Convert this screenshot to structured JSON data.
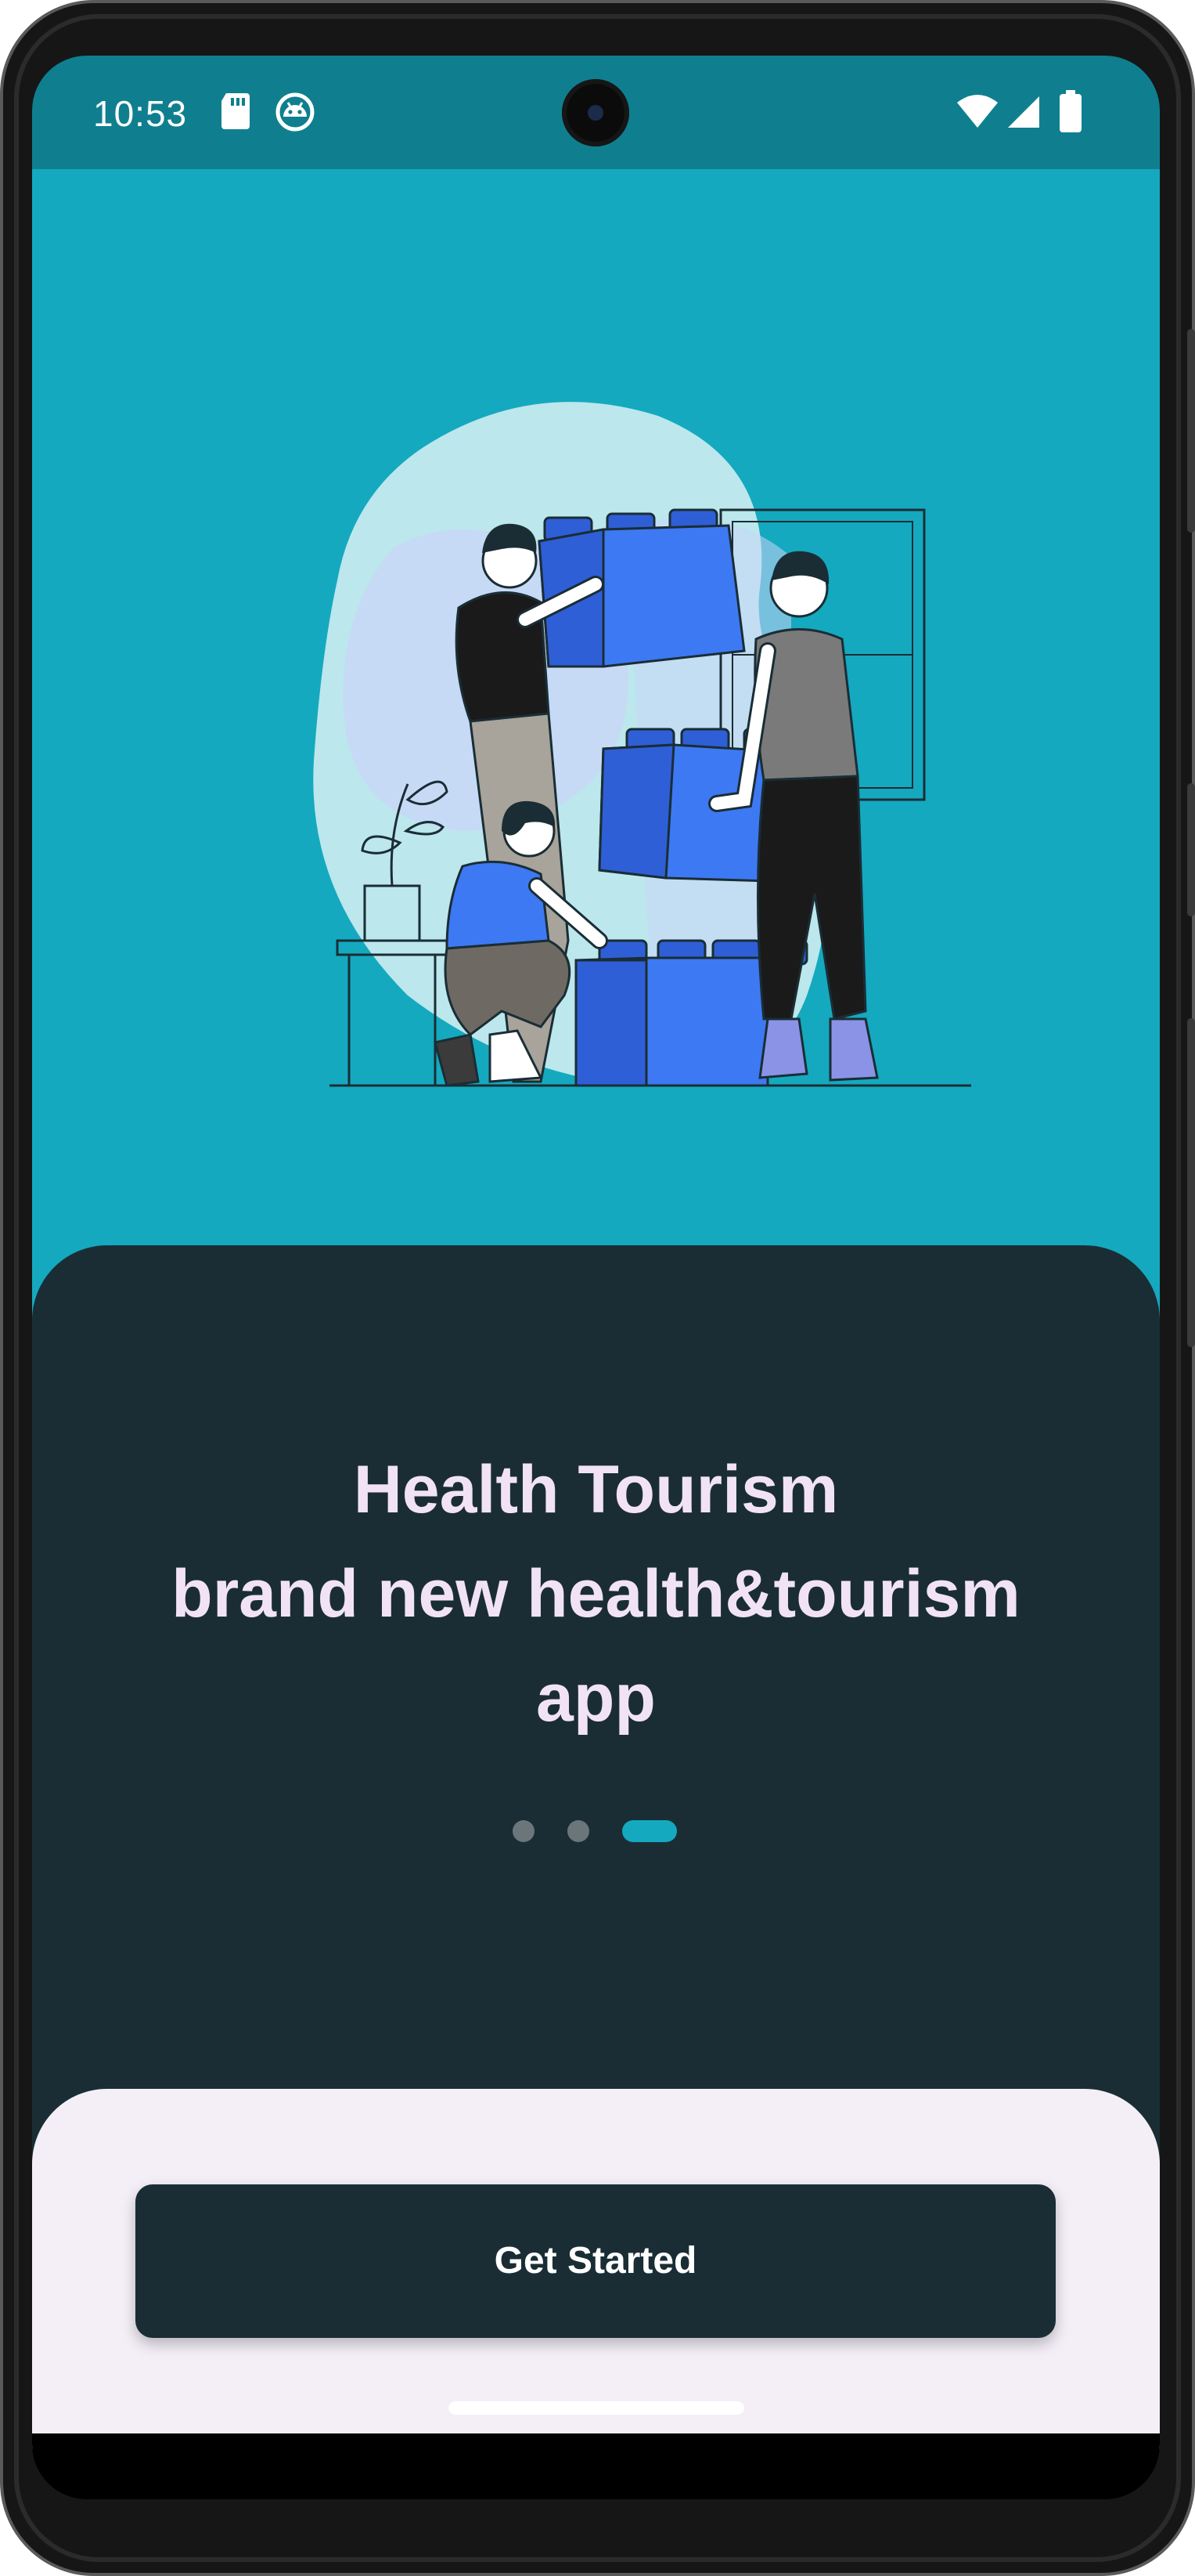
{
  "status_bar": {
    "time": "10:53",
    "left_icons": [
      "sd-card-icon",
      "android-debug-icon"
    ],
    "right_icons": [
      "wifi-icon",
      "cell-signal-icon",
      "battery-icon"
    ],
    "background_color": "#0f7f8f"
  },
  "hero": {
    "background_color": "#14a9bf",
    "illustration": "people-stacking-blocks-illustration"
  },
  "content": {
    "title_line_1": "Health Tourism",
    "title_line_2": "brand new health&tourism",
    "title_line_3": "app",
    "panel_color": "#1a2d35",
    "text_color": "#f1e3f5"
  },
  "pager": {
    "total_pages": 3,
    "active_page": 3,
    "active_color": "#14a9bf"
  },
  "actions": {
    "get_started_label": "Get Started"
  }
}
